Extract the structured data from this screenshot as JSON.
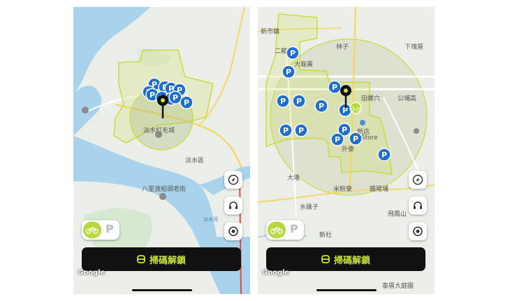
{
  "left_screen": {
    "labels": [
      {
        "text": "淡水紅毛城"
      },
      {
        "text": "淡水區"
      },
      {
        "text": "八里渡船頭老街"
      },
      {
        "text": "淡水河"
      }
    ],
    "parking_label": "P",
    "toggle_p_label": "P",
    "scan_button_label": "掃碼解鎖",
    "google_label": "Google"
  },
  "right_screen": {
    "labels": [
      {
        "text": "新市鎮"
      },
      {
        "text": "二龍高"
      },
      {
        "text": "林子"
      },
      {
        "text": "下塊厝"
      },
      {
        "text": "大龜崙"
      },
      {
        "text": "田螺穴"
      },
      {
        "text": "公埔高"
      },
      {
        "text": "新店"
      },
      {
        "text": "Store"
      },
      {
        "text": "外寮"
      },
      {
        "text": "大堵"
      },
      {
        "text": "米粉寮"
      },
      {
        "text": "鐵尾埔"
      },
      {
        "text": "水碓子"
      },
      {
        "text": "飛鳳山"
      },
      {
        "text": "新社"
      },
      {
        "text": "泰厝大庭園"
      }
    ],
    "parking_label": "P",
    "toggle_p_label": "P",
    "scan_button_label": "掃碼解鎖",
    "google_label": "Google"
  },
  "colors": {
    "zone_outline": "#c6dc3a",
    "parking_blue": "#1e6fd0",
    "accent_lime": "#c8e632",
    "water": "#a9d3ec",
    "land": "#eceeea"
  }
}
